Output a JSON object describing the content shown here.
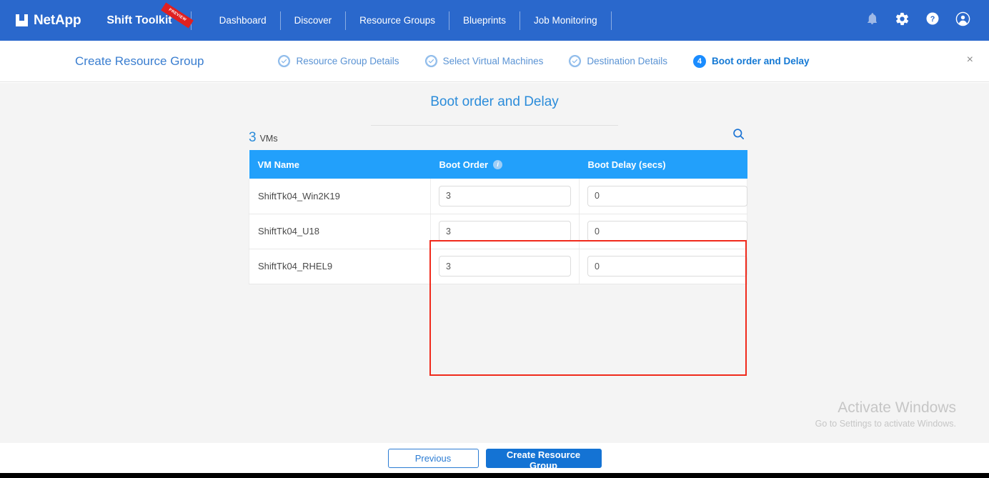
{
  "topbar": {
    "brand": "NetApp",
    "brand_icon": "netapp-logo-icon",
    "product": "Shift Toolkit",
    "ribbon": "PREVIEW",
    "nav_items": [
      {
        "label": "Dashboard"
      },
      {
        "label": "Discover"
      },
      {
        "label": "Resource Groups"
      },
      {
        "label": "Blueprints"
      },
      {
        "label": "Job Monitoring"
      }
    ],
    "icons": [
      {
        "name": "notifications-bell-icon"
      },
      {
        "name": "settings-gear-icon"
      },
      {
        "name": "help-question-icon"
      },
      {
        "name": "user-account-icon"
      }
    ]
  },
  "wizard": {
    "title": "Create Resource Group",
    "close_label": "×",
    "steps": [
      {
        "label": "Resource Group Details",
        "state": "done",
        "marker": "✓"
      },
      {
        "label": "Select Virtual Machines",
        "state": "done",
        "marker": "✓"
      },
      {
        "label": "Destination Details",
        "state": "done",
        "marker": "✓"
      },
      {
        "label": "Boot order and Delay",
        "state": "active",
        "marker": "4"
      }
    ]
  },
  "main": {
    "page_title": "Boot order and Delay",
    "count_number": "3",
    "count_label": "VMs",
    "search_icon": "search-icon",
    "table": {
      "columns": [
        {
          "label": "VM Name",
          "info": false
        },
        {
          "label": "Boot Order",
          "info": true,
          "info_glyph": "i"
        },
        {
          "label": "Boot Delay (secs)",
          "info": false
        }
      ],
      "rows": [
        {
          "name": "ShiftTk04_Win2K19",
          "boot_order": "3",
          "boot_delay": "0"
        },
        {
          "name": "ShiftTk04_U18",
          "boot_order": "3",
          "boot_delay": "0"
        },
        {
          "name": "ShiftTk04_RHEL9",
          "boot_order": "3",
          "boot_delay": "0"
        }
      ]
    }
  },
  "watermark": {
    "title": "Activate Windows",
    "subtitle": "Go to Settings to activate Windows."
  },
  "footer": {
    "previous_label": "Previous",
    "create_label": "Create Resource Group"
  },
  "colors": {
    "header_blue": "#2a68cc",
    "table_header_blue": "#22a0fb",
    "accent_blue": "#2b8cda",
    "primary_button": "#1473d4",
    "annotation_red": "#f02a1c"
  }
}
